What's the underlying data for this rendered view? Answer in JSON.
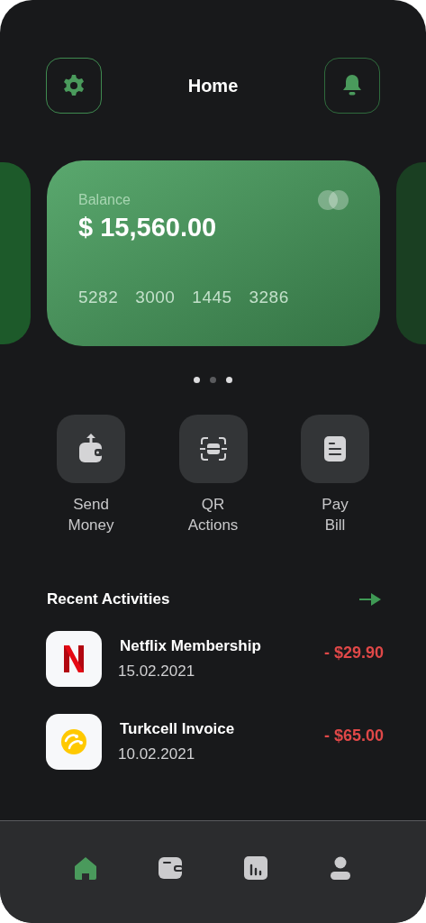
{
  "header": {
    "title": "Home"
  },
  "card": {
    "label": "Balance",
    "amount": "$ 15,560.00",
    "number_groups": [
      "5282",
      "3000",
      "1445",
      "3286"
    ]
  },
  "carousel_dots": [
    {
      "selected": true
    },
    {
      "selected": false
    },
    {
      "selected": true
    }
  ],
  "actions": [
    {
      "kind": "send",
      "label": "Send\nMoney"
    },
    {
      "kind": "qr",
      "label": "QR\nActions"
    },
    {
      "kind": "bill",
      "label": "Pay\nBill"
    }
  ],
  "recent": {
    "title": "Recent Activities",
    "items": [
      {
        "kind": "netflix",
        "name": "Netflix Membership",
        "date": "15.02.2021",
        "amount": "- $29.90"
      },
      {
        "kind": "turkcell",
        "name": "Turkcell Invoice",
        "date": "10.02.2021",
        "amount": "- $65.00"
      }
    ]
  },
  "nav": [
    {
      "kind": "home",
      "selected": true
    },
    {
      "kind": "wallet",
      "selected": false
    },
    {
      "kind": "stats",
      "selected": false
    },
    {
      "kind": "profile",
      "selected": false
    }
  ]
}
